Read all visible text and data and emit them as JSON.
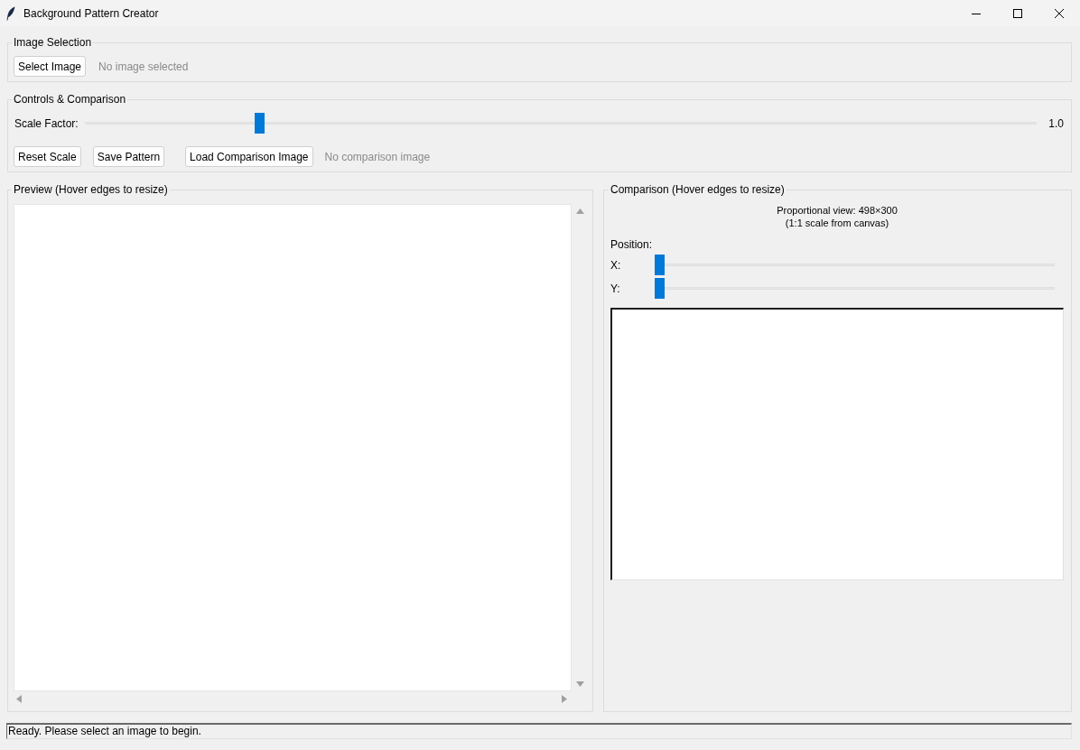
{
  "window": {
    "title": "Background Pattern Creator"
  },
  "image_selection": {
    "title": "Image Selection",
    "button": "Select Image",
    "status": "No image selected"
  },
  "controls": {
    "title": "Controls & Comparison",
    "scale": {
      "label": "Scale Factor:",
      "level": 0.18,
      "reading": "1.0"
    },
    "buttons": [
      "Reset Scale",
      "Save Pattern",
      "Load Comparison Image"
    ],
    "comparison_status": "No comparison image"
  },
  "preview": {
    "title": "Preview (Hover edges to resize)"
  },
  "comparison": {
    "title": "Comparison (Hover edges to resize)",
    "info": [
      "Proportional view: 498×300",
      "(1:1 scale from canvas)"
    ],
    "position_label": "Position:",
    "sliders": [
      {
        "label": "X:",
        "level": 0
      },
      {
        "label": "Y:",
        "level": 0
      }
    ]
  },
  "status_bar": {
    "text": "Ready. Please select an image to begin."
  }
}
